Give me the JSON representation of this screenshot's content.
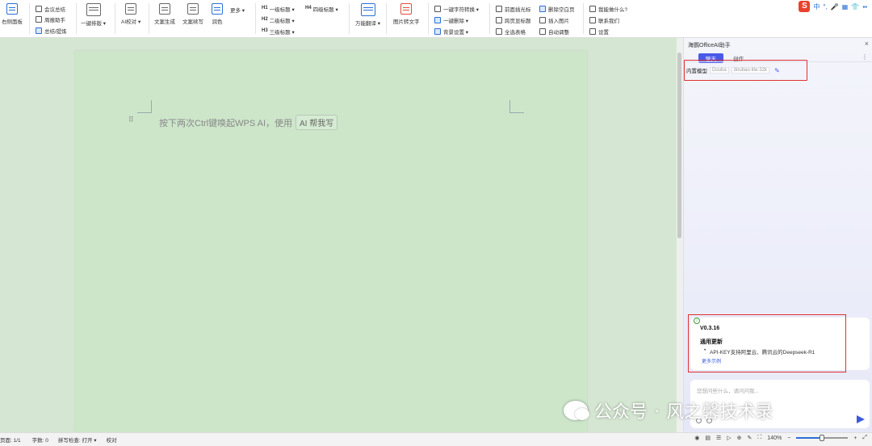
{
  "ribbon": {
    "group1": {
      "big": "右侧面板"
    },
    "group2": {
      "items": [
        "会议总结",
        "周报助手",
        "总结/提炼"
      ]
    },
    "group3": {
      "big": "一键排版 ▾"
    },
    "group4": {
      "big": "AI校对 ▾"
    },
    "group5": {
      "big1": "文案生成",
      "big2": "文案续写",
      "big3": "润色",
      "more": "更多 ▾"
    },
    "headings": {
      "h1": "一级标题 ▾",
      "h2": "二级标题 ▾",
      "h3": "三级标题 ▾",
      "h4": "四级标题 ▾",
      "h1_tag": "H1",
      "h2_tag": "H2",
      "h3_tag": "H3",
      "h4_tag": "H4"
    },
    "group7": {
      "big": "万能翻译 ▾"
    },
    "group8": {
      "big": "图片转文字"
    },
    "group9": {
      "items": [
        "一键字符转换 ▾",
        "一键删除 ▾",
        "背景设置 ▾"
      ]
    },
    "group10": {
      "items": [
        "前面插光标",
        "跨页显标题",
        "全选表格"
      ]
    },
    "group11": {
      "items": [
        "删除空白页",
        "插入图片",
        "自动调整"
      ]
    },
    "group12": {
      "items": [
        "我能做什么?",
        "联系我们",
        "设置"
      ]
    },
    "tray": {
      "s_logo": "S",
      "items": [
        "中",
        "°,",
        "🎤",
        "▦",
        "👕",
        "▪▪"
      ]
    }
  },
  "document": {
    "hint_text": "按下两次Ctrl键唤起WPS AI，使用",
    "ai_chip": "AI 帮我写"
  },
  "panel": {
    "title": "海鹦OfficeAI助手",
    "close": "×",
    "tabs": {
      "active": "聊天",
      "other": "创作"
    },
    "more": "⋮",
    "model_label": "内置模型",
    "model_provider": "Douba",
    "model_name": "doubao-lite-32k",
    "update_card": {
      "version": "V0.3.16",
      "heading": "通用更新",
      "item": "API-KEY支持阿里云、腾讯云的Deepseek-R1",
      "link": "更多示例"
    },
    "input_placeholder": "您想问些什么，请问问我..."
  },
  "watermark": {
    "text1": "公众号",
    "sep": "·",
    "text2": "风之馨技术录"
  },
  "statusbar": {
    "page": "页面: 1/1",
    "words": "字数: 0",
    "spell": "拼写检查: 打开 ▾",
    "proof": "校对",
    "zoom": "140%",
    "zoom_level": 0.5,
    "minus": "−",
    "plus": "+"
  }
}
